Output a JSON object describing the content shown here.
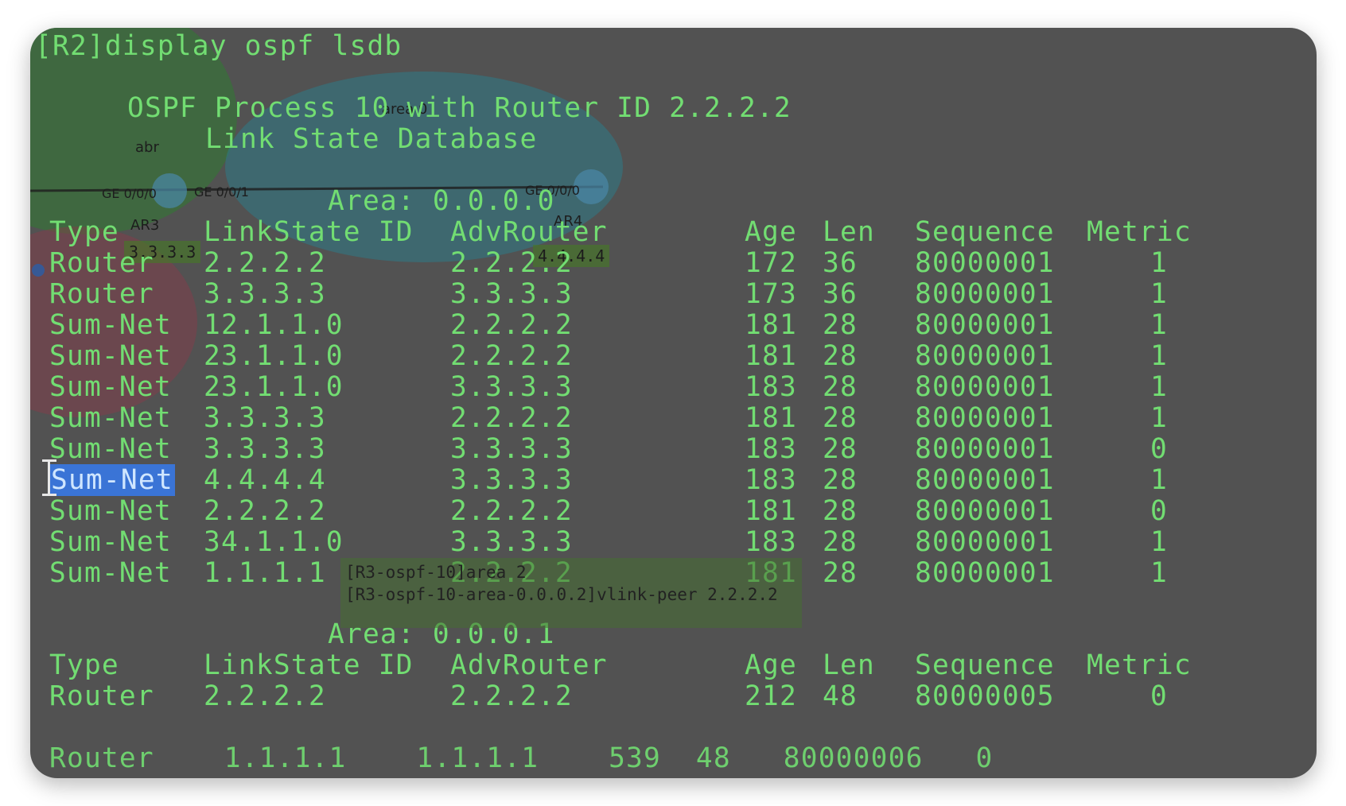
{
  "terminal": {
    "command": "[R2]display ospf lsdb",
    "header1": "OSPF Process 10 with Router ID 2.2.2.2",
    "header2": "Link State Database",
    "area0": {
      "title": "Area: 0.0.0.0",
      "columns": [
        "Type",
        "LinkState ID",
        "AdvRouter",
        "Age",
        "Len",
        "Sequence",
        "Metric"
      ],
      "rows": [
        [
          "Router",
          "2.2.2.2",
          "2.2.2.2",
          "172",
          "36",
          "80000001",
          "1"
        ],
        [
          "Router",
          "3.3.3.3",
          "3.3.3.3",
          "173",
          "36",
          "80000001",
          "1"
        ],
        [
          "Sum-Net",
          "12.1.1.0",
          "2.2.2.2",
          "181",
          "28",
          "80000001",
          "1"
        ],
        [
          "Sum-Net",
          "23.1.1.0",
          "2.2.2.2",
          "181",
          "28",
          "80000001",
          "1"
        ],
        [
          "Sum-Net",
          "23.1.1.0",
          "3.3.3.3",
          "183",
          "28",
          "80000001",
          "1"
        ],
        [
          "Sum-Net",
          "3.3.3.3",
          "2.2.2.2",
          "181",
          "28",
          "80000001",
          "1"
        ],
        [
          "Sum-Net",
          "3.3.3.3",
          "3.3.3.3",
          "183",
          "28",
          "80000001",
          "0"
        ],
        [
          "Sum-Net",
          "4.4.4.4",
          "3.3.3.3",
          "183",
          "28",
          "80000001",
          "1"
        ],
        [
          "Sum-Net",
          "2.2.2.2",
          "2.2.2.2",
          "181",
          "28",
          "80000001",
          "0"
        ],
        [
          "Sum-Net",
          "34.1.1.0",
          "3.3.3.3",
          "183",
          "28",
          "80000001",
          "1"
        ],
        [
          "Sum-Net",
          "1.1.1.1",
          "2.2.2.2",
          "181",
          "28",
          "80000001",
          "1"
        ]
      ]
    },
    "area1": {
      "title": "Area: 0.0.0.1",
      "columns": [
        "Type",
        "LinkState ID",
        "AdvRouter",
        "Age",
        "Len",
        "Sequence",
        "Metric"
      ],
      "rows": [
        [
          "Router",
          "2.2.2.2",
          "2.2.2.2",
          "212",
          "48",
          "80000005",
          "0"
        ]
      ]
    }
  },
  "overlay": {
    "topology_labels": {
      "area": "area 0",
      "abr": "abr",
      "ge1": "GE 0/0/0",
      "ge2": "GE 0/0/1",
      "ge3": "GE 0/0/0",
      "ar3": "AR3",
      "ar4": "AR4",
      "addr3": "3.3.3.3",
      "addr4": "4.4.4.4"
    },
    "cmd_lines": [
      "[R3-ospf-10]area 2",
      "[R3-ospf-10-area-0.0.0.2]vlink-peer 2.2.2.2"
    ]
  },
  "colors": {
    "terminal_bg": "#525252",
    "terminal_text": "#72dd72",
    "selection": "#3a74d6"
  }
}
